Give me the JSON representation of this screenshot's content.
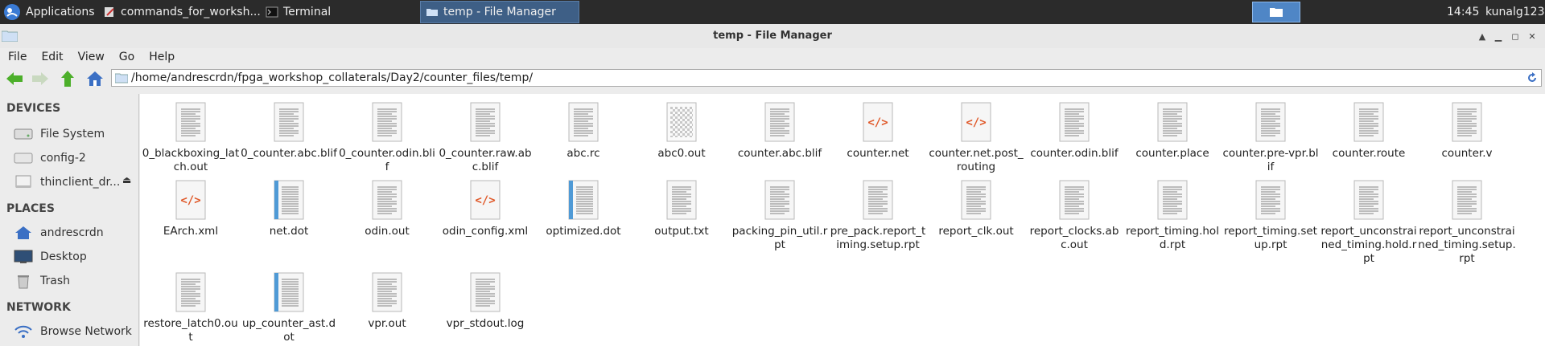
{
  "taskbar": {
    "applications_label": "Applications",
    "tasks": [
      {
        "label": "commands_for_worksh..."
      },
      {
        "label": "Terminal"
      },
      {
        "label": "temp - File Manager"
      }
    ],
    "clock": "14:45",
    "user": "kunalg123"
  },
  "window": {
    "title": "temp - File Manager"
  },
  "menu": [
    "File",
    "Edit",
    "View",
    "Go",
    "Help"
  ],
  "location": {
    "path": "/home/andrescrdn/fpga_workshop_collaterals/Day2/counter_files/temp/"
  },
  "sidebar": {
    "devices_title": "DEVICES",
    "devices": [
      {
        "label": "File System"
      },
      {
        "label": "config-2"
      },
      {
        "label": "thinclient_dr..."
      }
    ],
    "places_title": "PLACES",
    "places": [
      {
        "label": "andrescrdn"
      },
      {
        "label": "Desktop"
      },
      {
        "label": "Trash"
      }
    ],
    "network_title": "NETWORK",
    "network": [
      {
        "label": "Browse Network"
      }
    ]
  },
  "files": [
    {
      "name": "0_blackboxing_latch.out",
      "icon": "text-file-icon"
    },
    {
      "name": "0_counter.abc.blif",
      "icon": "text-file-icon"
    },
    {
      "name": "0_counter.odin.blif",
      "icon": "text-file-icon"
    },
    {
      "name": "0_counter.raw.abc.blif",
      "icon": "text-file-icon"
    },
    {
      "name": "abc.rc",
      "icon": "text-file-icon"
    },
    {
      "name": "abc0.out",
      "icon": "binary-file-icon"
    },
    {
      "name": "counter.abc.blif",
      "icon": "text-file-icon"
    },
    {
      "name": "counter.net",
      "icon": "xml-file-icon"
    },
    {
      "name": "counter.net.post_routing",
      "icon": "xml-file-icon"
    },
    {
      "name": "counter.odin.blif",
      "icon": "text-file-icon"
    },
    {
      "name": "counter.place",
      "icon": "text-file-icon"
    },
    {
      "name": "counter.pre-vpr.blif",
      "icon": "text-file-icon"
    },
    {
      "name": "counter.route",
      "icon": "text-file-icon"
    },
    {
      "name": "counter.v",
      "icon": "text-file-icon"
    },
    {
      "name": "EArch.xml",
      "icon": "xml-file-icon"
    },
    {
      "name": "net.dot",
      "icon": "dot-file-icon"
    },
    {
      "name": "odin.out",
      "icon": "text-file-icon"
    },
    {
      "name": "odin_config.xml",
      "icon": "xml-file-icon"
    },
    {
      "name": "optimized.dot",
      "icon": "dot-file-icon"
    },
    {
      "name": "output.txt",
      "icon": "text-file-icon"
    },
    {
      "name": "packing_pin_util.rpt",
      "icon": "text-file-icon"
    },
    {
      "name": "pre_pack.report_timing.setup.rpt",
      "icon": "text-file-icon"
    },
    {
      "name": "report_clk.out",
      "icon": "text-file-icon"
    },
    {
      "name": "report_clocks.abc.out",
      "icon": "text-file-icon"
    },
    {
      "name": "report_timing.hold.rpt",
      "icon": "text-file-icon"
    },
    {
      "name": "report_timing.setup.rpt",
      "icon": "text-file-icon"
    },
    {
      "name": "report_unconstrained_timing.hold.rpt",
      "icon": "text-file-icon"
    },
    {
      "name": "report_unconstrained_timing.setup.rpt",
      "icon": "text-file-icon"
    },
    {
      "name": "restore_latch0.out",
      "icon": "text-file-icon"
    },
    {
      "name": "up_counter_ast.dot",
      "icon": "dot-file-icon"
    },
    {
      "name": "vpr.out",
      "icon": "text-file-icon"
    },
    {
      "name": "vpr_stdout.log",
      "icon": "text-file-icon"
    }
  ],
  "colors": {
    "xml_tag": "#e05a2b",
    "dot_stripe": "#4f9ad6",
    "nav_arrow_green": "#4caf2a",
    "home_blue": "#3a6fc4"
  }
}
